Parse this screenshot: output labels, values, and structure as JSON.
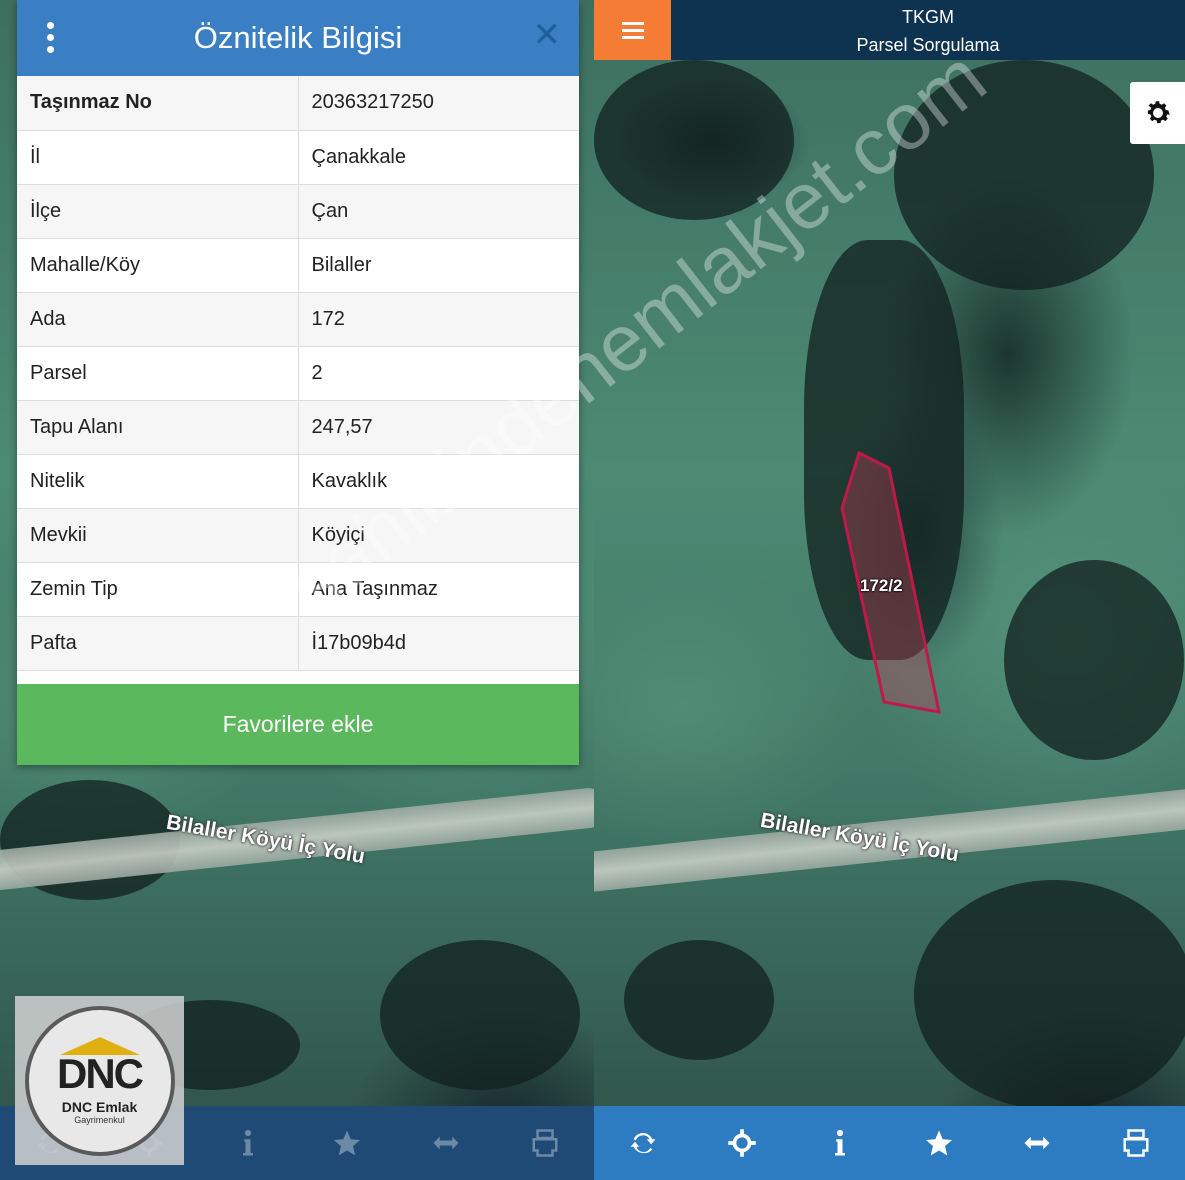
{
  "left": {
    "dialog": {
      "title": "Öznitelik Bilgisi",
      "rows": [
        {
          "key": "Taşınmaz No",
          "value": "20363217250"
        },
        {
          "key": "İl",
          "value": "Çanakkale"
        },
        {
          "key": "İlçe",
          "value": "Çan"
        },
        {
          "key": "Mahalle/Köy",
          "value": "Bilaller"
        },
        {
          "key": "Ada",
          "value": "172"
        },
        {
          "key": "Parsel",
          "value": "2"
        },
        {
          "key": "Tapu Alanı",
          "value": "247,57"
        },
        {
          "key": "Nitelik",
          "value": "Kavaklık"
        },
        {
          "key": "Mevkii",
          "value": "Köyiçi"
        },
        {
          "key": "Zemin Tip",
          "value": "Ana Taşınmaz"
        },
        {
          "key": "Pafta",
          "value": "İ17b09b4d"
        }
      ],
      "favorite_label": "Favorilere ekle"
    },
    "road_label": "Bilaller Köyü İç Yolu",
    "logo": {
      "main": "DNC",
      "sub": "DNC Emlak",
      "sub2": "Gayrimenkul"
    }
  },
  "right": {
    "header": {
      "line1": "TKGM",
      "line2": "Parsel Sorgulama"
    },
    "parcel_label": "172/2",
    "road_label": "Bilaller Köyü İç Yolu"
  },
  "toolbar_icons": [
    "refresh-icon",
    "locate-icon",
    "info-icon",
    "star-icon",
    "measure-icon",
    "print-icon"
  ],
  "watermark": "sahibindenemlakjet.com",
  "colors": {
    "header_blue": "#3a7fc4",
    "favorite_green": "#5cb85c",
    "toolbar_blue": "#2d7bc0",
    "hamburger_orange": "#f47c35",
    "app_header_navy": "#0d3350",
    "parcel_outline": "#c0184a"
  }
}
